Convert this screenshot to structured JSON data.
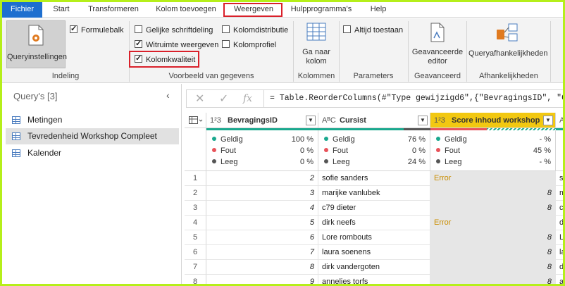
{
  "tabs": [
    "Fichier",
    "Start",
    "Transformeren",
    "Kolom toevoegen",
    "Weergeven",
    "Hulpprogramma's",
    "Help"
  ],
  "ribbon": {
    "indeling": {
      "query_settings_label": "Queryinstellingen",
      "formula_bar_label": "Formulebalk",
      "group_label": "Indeling"
    },
    "preview": {
      "checkboxes": [
        {
          "label": "Gelijke schriftdeling",
          "checked": false
        },
        {
          "label": "Witruimte weergeven",
          "checked": true
        },
        {
          "label": "Kolomkwaliteit",
          "checked": true
        },
        {
          "label": "Kolomdistributie",
          "checked": false
        },
        {
          "label": "Kolomprofiel",
          "checked": false
        }
      ],
      "group_label": "Voorbeeld van gegevens"
    },
    "kolommen": {
      "button_line1": "Ga naar",
      "button_line2": "kolom",
      "group_label": "Kolommen"
    },
    "parameters": {
      "checkbox_label": "Altijd toestaan",
      "group_label": "Parameters"
    },
    "geavanceerd": {
      "button_line1": "Geavanceerde",
      "button_line2": "editor",
      "group_label": "Geavanceerd"
    },
    "afhankelijkheden": {
      "button_label": "Queryafhankelijkheden",
      "group_label": "Afhankelijkheden"
    }
  },
  "queries": {
    "title": "Query's [3]",
    "items": [
      "Metingen",
      "Tevredenheid Workshop Compleet",
      "Kalender"
    ],
    "selected_index": 1
  },
  "formula": {
    "text": "= Table.ReorderColumns(#\"Type gewijzigd6\",{\"BevragingsID\", \"Cur"
  },
  "grid": {
    "columns": [
      {
        "type": "1²3",
        "name": "BevragingsID",
        "valid": "100 %",
        "error": "0 %",
        "empty": "0 %"
      },
      {
        "type": "AᴮC",
        "name": "Cursist",
        "valid": "76 %",
        "error": "0 %",
        "empty": "24 %"
      },
      {
        "type": "1²3",
        "name": "Score inhoud workshop",
        "valid": "- %",
        "error": "45 %",
        "empty": "- %"
      }
    ],
    "stat_labels": {
      "valid": "Geldig",
      "error": "Fout",
      "empty": "Leeg"
    },
    "rows": [
      {
        "n": "1",
        "id": "2",
        "cursist": "sofie sanders",
        "score": "Error",
        "next": "so"
      },
      {
        "n": "2",
        "id": "3",
        "cursist": "marijke vanlubek",
        "score": "8",
        "next": "m"
      },
      {
        "n": "3",
        "id": "4",
        "cursist": "c79 dieter",
        "score": "8",
        "next": "c"
      },
      {
        "n": "4",
        "id": "5",
        "cursist": "dirk neefs",
        "score": "Error",
        "next": "d"
      },
      {
        "n": "5",
        "id": "6",
        "cursist": "Lore rombouts",
        "score": "8",
        "next": "Lo"
      },
      {
        "n": "6",
        "id": "7",
        "cursist": "laura soenens",
        "score": "8",
        "next": "la"
      },
      {
        "n": "7",
        "id": "8",
        "cursist": "dirk vandergoten",
        "score": "8",
        "next": "di"
      },
      {
        "n": "8",
        "id": "9",
        "cursist": "annelies torfs",
        "score": "8",
        "next": "an"
      }
    ]
  },
  "colors": {
    "accent": "#1e6fcf",
    "highlight": "#f2c811",
    "valid": "#1aa88e",
    "error": "#e8535a",
    "empty": "#555555",
    "frame": "#b5ef1a"
  }
}
